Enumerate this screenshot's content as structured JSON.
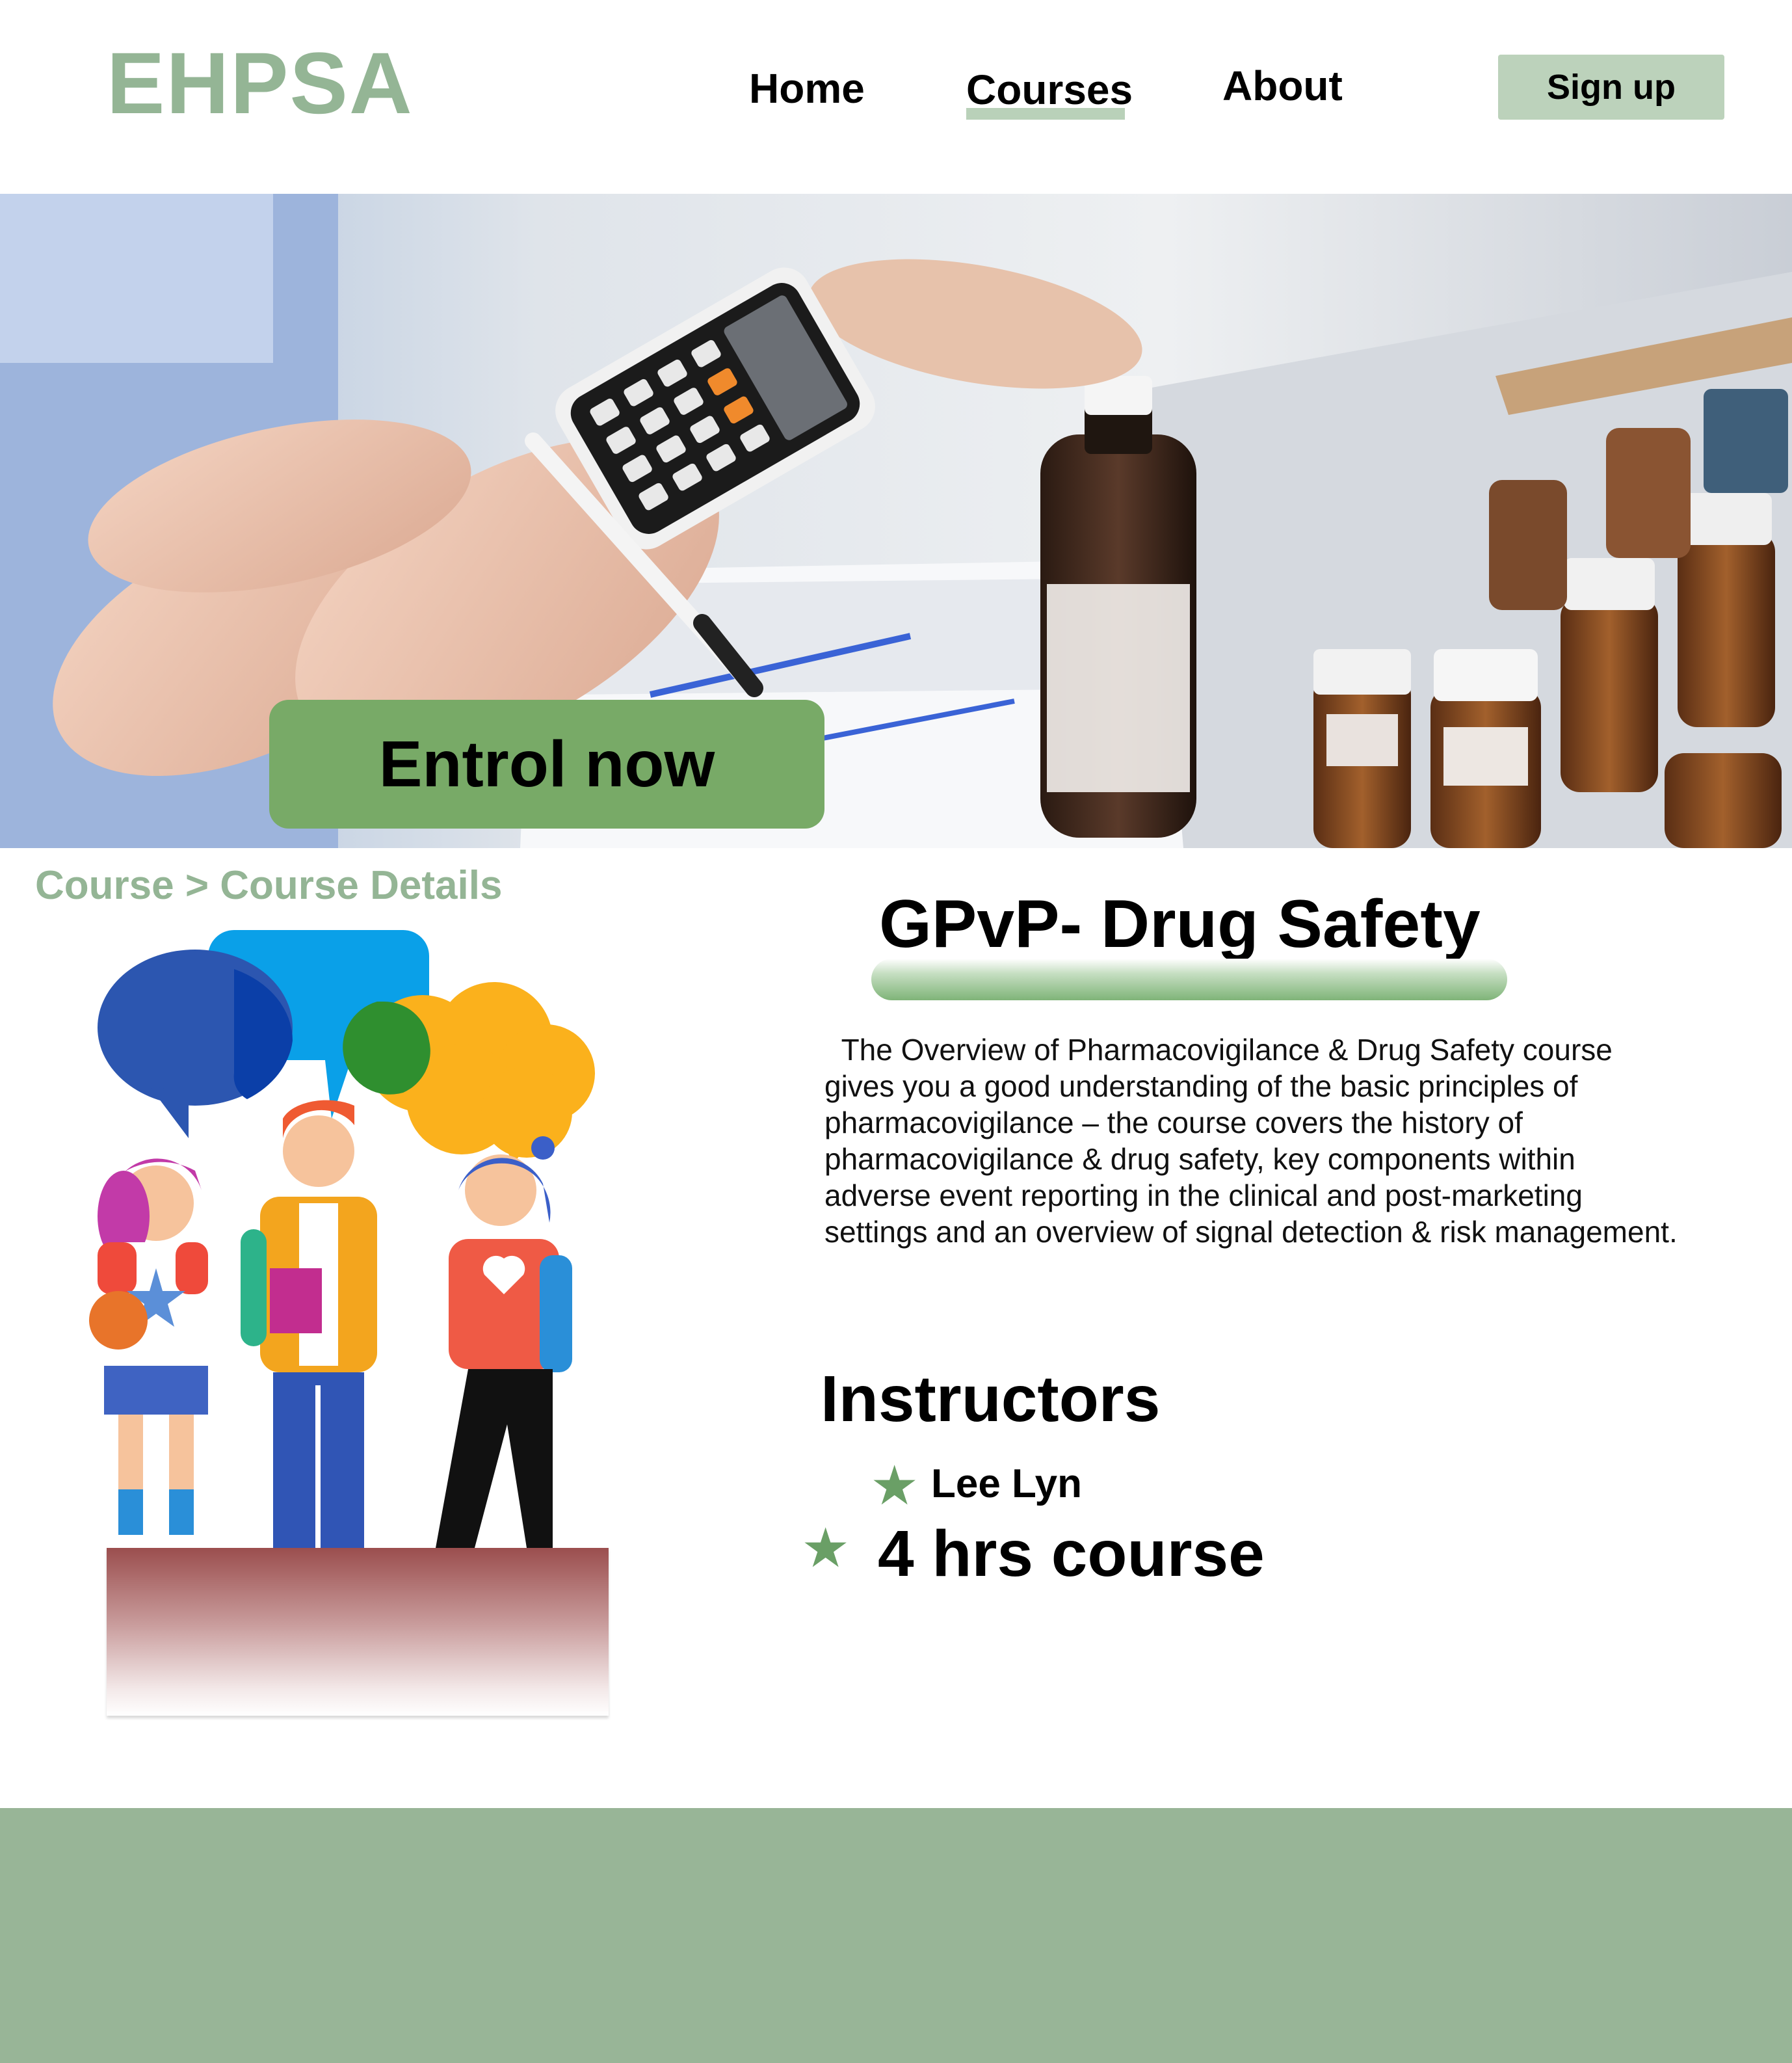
{
  "header": {
    "logo": "EHPSA",
    "nav": {
      "home": "Home",
      "courses": "Courses",
      "about": "About"
    },
    "signup_label": "Sign up"
  },
  "hero": {
    "enroll_label": "Entrol now"
  },
  "breadcrumb": "Course > Course Details",
  "course": {
    "title": "GPvP- Drug Safety",
    "description": "  The Overview of Pharmacovigilance & Drug Safety course gives you a good understanding of the basic principles of pharmacovigilance – the course covers the history of pharmacovigilance & drug safety, key components within adverse event reporting in the clinical and post-marketing settings and an overview of signal detection & risk management.",
    "instructors_heading": "Instructors",
    "instructor": "Lee Lyn",
    "duration": "4 hrs course"
  },
  "icons": {
    "bullet": "star-icon"
  },
  "colors": {
    "brand": "#94b595",
    "button": "#78aa67",
    "signup": "#bcd2bb",
    "footer": "#98b597"
  }
}
